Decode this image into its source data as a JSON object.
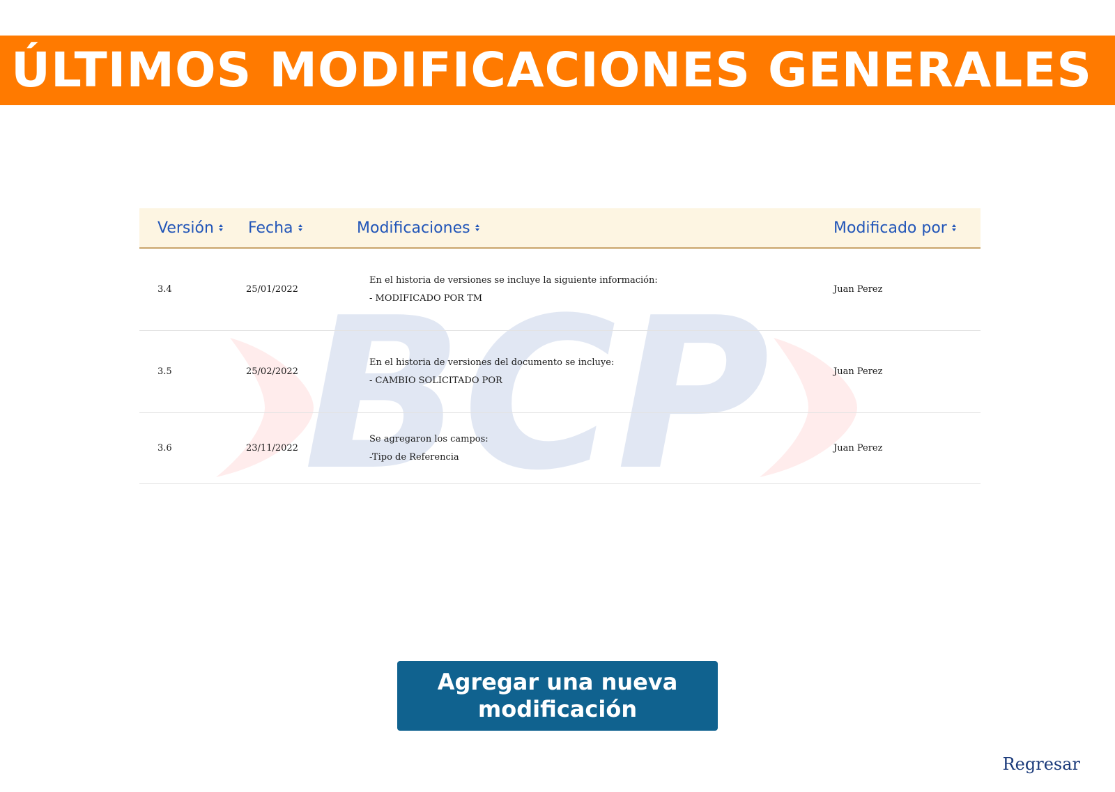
{
  "header": {
    "title": "ÚLTIMOS MODIFICACIONES GENERALES"
  },
  "watermark": {
    "text": "BCP"
  },
  "table": {
    "columns": [
      "Versión",
      "Fecha",
      "Modificaciones",
      "Modificado por"
    ],
    "rows": [
      {
        "version": "3.4",
        "fecha": "25/01/2022",
        "modificaciones": [
          "En el historia de versiones se incluye la siguiente información:",
          "- MODIFICADO POR TM"
        ],
        "modificado_por": "Juan Perez"
      },
      {
        "version": "3.5",
        "fecha": "25/02/2022",
        "modificaciones": [
          "En el historia de versiones del documento se incluye:",
          "- CAMBIO SOLICITADO POR"
        ],
        "modificado_por": "Juan Perez"
      },
      {
        "version": "3.6",
        "fecha": "23/11/2022",
        "modificaciones": [
          "Se agregaron los campos:",
          "-Tipo de Referencia"
        ],
        "modificado_por": "Juan Perez"
      }
    ]
  },
  "actions": {
    "add_label": "Agregar una nueva modificación",
    "back_label": "Regresar"
  },
  "colors": {
    "banner": "#ff7a00",
    "header_bg": "#fdf5e2",
    "header_text": "#2155b8",
    "button": "#10628f",
    "link": "#1a3a7a"
  }
}
